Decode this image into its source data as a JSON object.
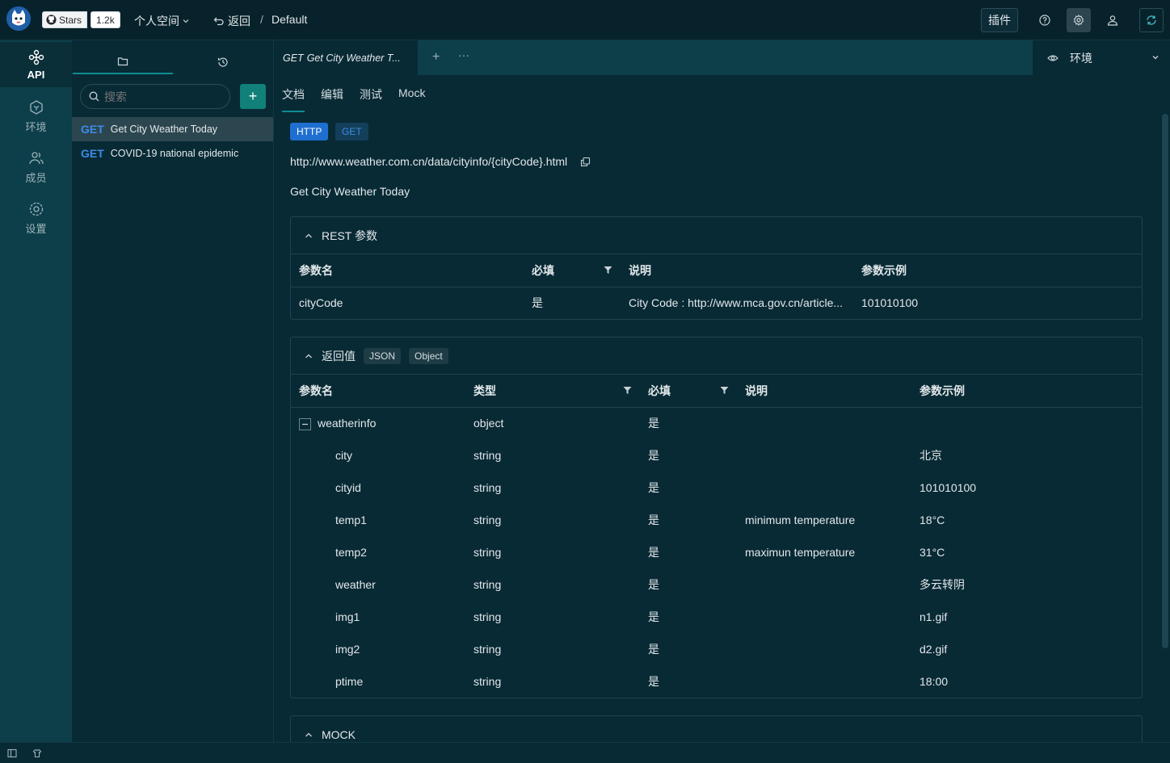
{
  "topbar": {
    "github_stars_label": "Stars",
    "github_stars_count": "1.2k",
    "workspace": "个人空间",
    "back_label": "返回",
    "breadcrumb_sep": "/",
    "breadcrumb_current": "Default",
    "plugin_label": "插件",
    "icons": [
      "help-icon",
      "settings-icon",
      "user-icon",
      "refresh-icon"
    ]
  },
  "leftnav": {
    "items": [
      {
        "label": "API",
        "icon": "api-icon",
        "active": true
      },
      {
        "label": "环境",
        "icon": "env-icon"
      },
      {
        "label": "成员",
        "icon": "members-icon"
      },
      {
        "label": "设置",
        "icon": "settings-icon"
      }
    ]
  },
  "sidebar": {
    "tabs": [
      "folder-icon",
      "history-icon"
    ],
    "search_placeholder": "搜索",
    "add_label": "+",
    "apis": [
      {
        "method": "GET",
        "name": "Get City Weather Today",
        "active": true
      },
      {
        "method": "GET",
        "name": "COVID-19 national epidemic"
      }
    ]
  },
  "tabs": {
    "active_method": "GET",
    "active_name": "Get City Weather T...",
    "plus": "+",
    "more": "···"
  },
  "env": {
    "label": "环境"
  },
  "content": {
    "subtabs": [
      "文档",
      "编辑",
      "测试",
      "Mock"
    ],
    "protocol": "HTTP",
    "method": "GET",
    "url": "http://www.weather.com.cn/data/cityinfo/{cityCode}.html",
    "description": "Get City Weather Today",
    "rest": {
      "title": "REST 参数",
      "headers": [
        "参数名",
        "必填",
        "说明",
        "参数示例"
      ],
      "rows": [
        {
          "name": "cityCode",
          "required": "是",
          "desc": "City Code : http://www.mca.gov.cn/article...",
          "example": "101010100"
        }
      ]
    },
    "response": {
      "title": "返回值",
      "format": "JSON",
      "type": "Object",
      "headers": [
        "参数名",
        "类型",
        "必填",
        "说明",
        "参数示例"
      ],
      "root": {
        "name": "weatherinfo",
        "type": "object",
        "required": "是"
      },
      "rows": [
        {
          "name": "city",
          "type": "string",
          "required": "是",
          "desc": "",
          "example": "北京"
        },
        {
          "name": "cityid",
          "type": "string",
          "required": "是",
          "desc": "",
          "example": "101010100"
        },
        {
          "name": "temp1",
          "type": "string",
          "required": "是",
          "desc": "minimum temperature",
          "example": "18°C"
        },
        {
          "name": "temp2",
          "type": "string",
          "required": "是",
          "desc": "maximun temperature",
          "example": "31°C"
        },
        {
          "name": "weather",
          "type": "string",
          "required": "是",
          "desc": "",
          "example": "多云转阴"
        },
        {
          "name": "img1",
          "type": "string",
          "required": "是",
          "desc": "",
          "example": "n1.gif"
        },
        {
          "name": "img2",
          "type": "string",
          "required": "是",
          "desc": "",
          "example": "d2.gif"
        },
        {
          "name": "ptime",
          "type": "string",
          "required": "是",
          "desc": "",
          "example": "18:00"
        }
      ]
    },
    "mock": {
      "title": "MOCK"
    }
  },
  "colors": {
    "background": "#082a35",
    "nav": "#0d3f4b",
    "accent": "#0e8c93",
    "method": "#3c8ce7"
  }
}
